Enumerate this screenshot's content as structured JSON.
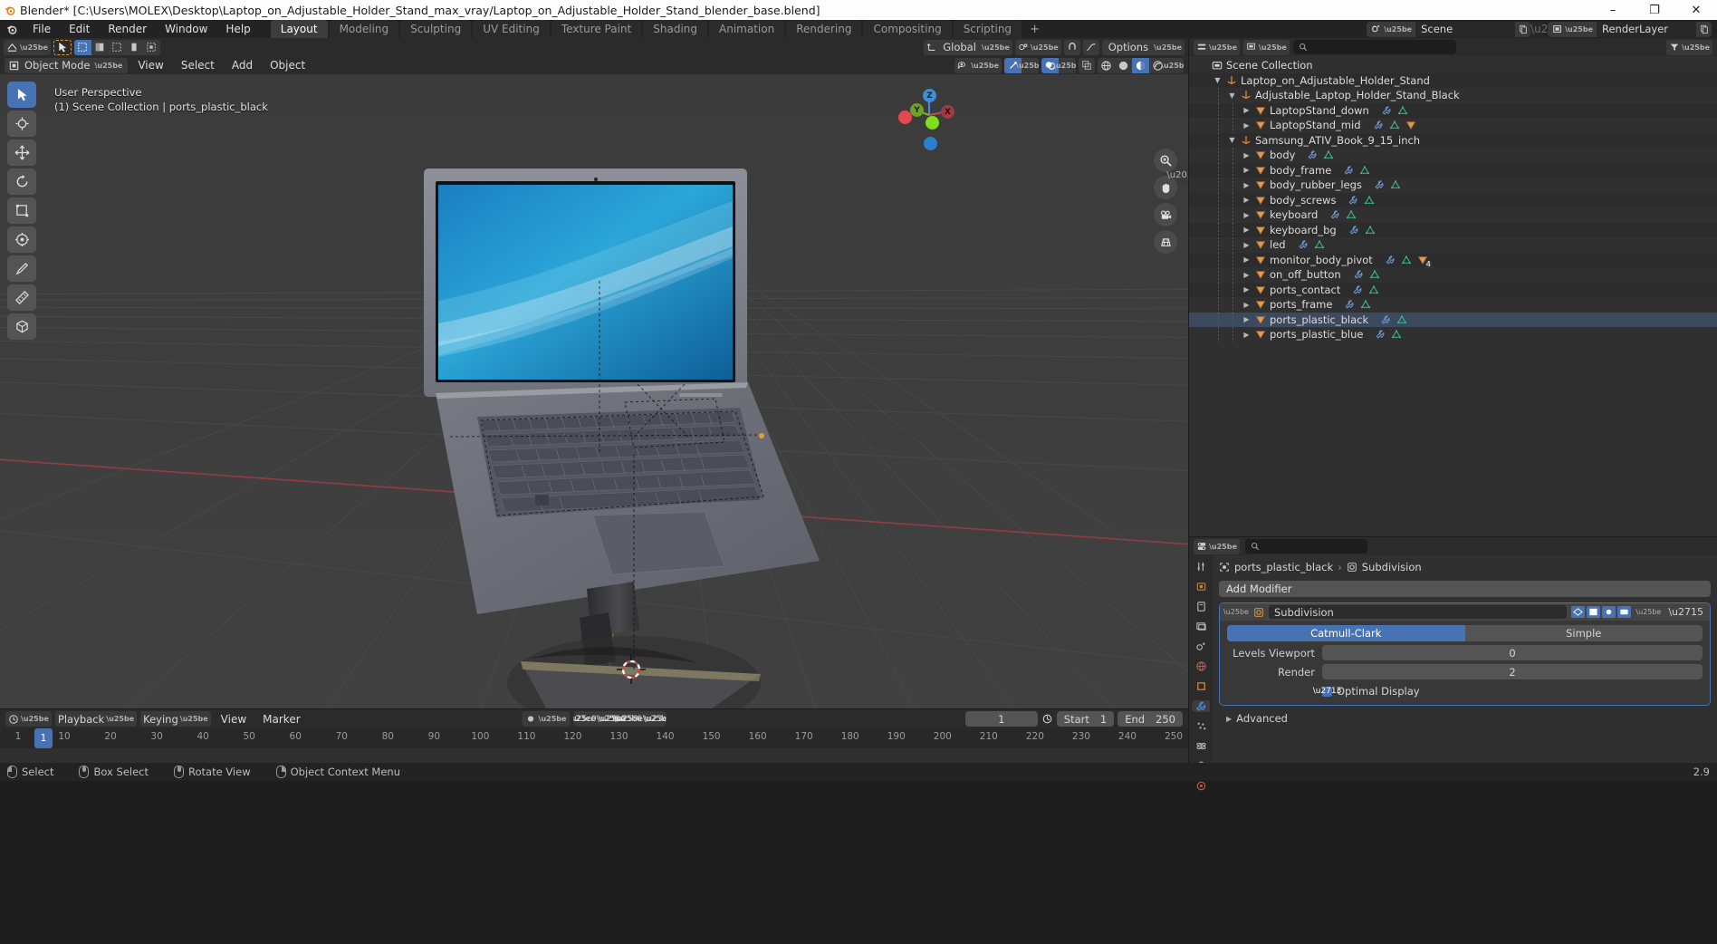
{
  "window": {
    "title": "Blender* [C:\\Users\\MOLEX\\Desktop\\Laptop_on_Adjustable_Holder_Stand_max_vray/Laptop_on_Adjustable_Holder_Stand_blender_base.blend]",
    "minimize": "–",
    "maximize": "❐",
    "close": "✕"
  },
  "topbar": {
    "menus": [
      "File",
      "Edit",
      "Render",
      "Window",
      "Help"
    ],
    "workspaces": [
      {
        "label": "Layout",
        "active": true
      },
      {
        "label": "Modeling",
        "active": false
      },
      {
        "label": "Sculpting",
        "active": false
      },
      {
        "label": "UV Editing",
        "active": false
      },
      {
        "label": "Texture Paint",
        "active": false
      },
      {
        "label": "Shading",
        "active": false
      },
      {
        "label": "Animation",
        "active": false
      },
      {
        "label": "Rendering",
        "active": false
      },
      {
        "label": "Compositing",
        "active": false
      },
      {
        "label": "Scripting",
        "active": false
      }
    ],
    "add_workspace": "+",
    "scene_name": "Scene",
    "view_layer_name": "RenderLayer"
  },
  "viewport_header": {
    "editor_type": "editor-type-icon",
    "transform_orientation": "Global",
    "options_label": "Options",
    "snap_icon": "magnet-icon",
    "proportional_icon": "proportional-edit-icon"
  },
  "tool_header": {
    "mode": "Object Mode",
    "menus": [
      "View",
      "Select",
      "Add",
      "Object"
    ]
  },
  "viewport": {
    "perspective_label": "User Perspective",
    "collection_label": "(1) Scene Collection | ports_plastic_black",
    "gizmo_axes": [
      "X",
      "Y",
      "Z"
    ],
    "axis_colors": {
      "x": "#c44a53",
      "y": "#7bb12a",
      "z": "#3f8ed6"
    },
    "background": "#3d3d3d"
  },
  "outliner": {
    "search_placeholder": "",
    "rows": [
      {
        "label": "Scene Collection",
        "depth": 0,
        "icon": "collection-icon",
        "expand": "",
        "selected": false,
        "icons": []
      },
      {
        "label": "Laptop_on_Adjustable_Holder_Stand",
        "depth": 1,
        "icon": "empty-axes-icon",
        "expand": "▼",
        "selected": false,
        "icons": []
      },
      {
        "label": "Adjustable_Laptop_Holder_Stand_Black",
        "depth": 2,
        "icon": "empty-axes-icon",
        "expand": "▼",
        "selected": false,
        "icons": []
      },
      {
        "label": "LaptopStand_down",
        "depth": 3,
        "icon": "mesh-data-icon",
        "expand": "▶",
        "selected": false,
        "icons": [
          "modifier-icon",
          "mesh-icon"
        ]
      },
      {
        "label": "LaptopStand_mid",
        "depth": 3,
        "icon": "mesh-data-icon",
        "expand": "▶",
        "selected": false,
        "icons": [
          "modifier-icon",
          "mesh-icon",
          "mesh-data-icon"
        ]
      },
      {
        "label": "Samsung_ATIV_Book_9_15_inch",
        "depth": 2,
        "icon": "empty-axes-icon",
        "expand": "▼",
        "selected": false,
        "icons": []
      },
      {
        "label": "body",
        "depth": 3,
        "icon": "mesh-data-icon",
        "expand": "▶",
        "selected": false,
        "icons": [
          "modifier-icon",
          "mesh-icon"
        ]
      },
      {
        "label": "body_frame",
        "depth": 3,
        "icon": "mesh-data-icon",
        "expand": "▶",
        "selected": false,
        "icons": [
          "modifier-icon",
          "mesh-icon"
        ]
      },
      {
        "label": "body_rubber_legs",
        "depth": 3,
        "icon": "mesh-data-icon",
        "expand": "▶",
        "selected": false,
        "icons": [
          "modifier-icon",
          "mesh-icon"
        ]
      },
      {
        "label": "body_screws",
        "depth": 3,
        "icon": "mesh-data-icon",
        "expand": "▶",
        "selected": false,
        "icons": [
          "modifier-icon",
          "mesh-icon"
        ]
      },
      {
        "label": "keyboard",
        "depth": 3,
        "icon": "mesh-data-icon",
        "expand": "▶",
        "selected": false,
        "icons": [
          "modifier-icon",
          "mesh-icon"
        ]
      },
      {
        "label": "keyboard_bg",
        "depth": 3,
        "icon": "mesh-data-icon",
        "expand": "▶",
        "selected": false,
        "icons": [
          "modifier-icon",
          "mesh-icon"
        ]
      },
      {
        "label": "led",
        "depth": 3,
        "icon": "mesh-data-icon",
        "expand": "▶",
        "selected": false,
        "icons": [
          "modifier-icon",
          "mesh-icon"
        ]
      },
      {
        "label": "monitor_body_pivot",
        "depth": 3,
        "icon": "mesh-data-icon",
        "expand": "▶",
        "selected": false,
        "icons": [
          "modifier-icon",
          "mesh-icon",
          "mesh-data-badge-4"
        ]
      },
      {
        "label": "on_off_button",
        "depth": 3,
        "icon": "mesh-data-icon",
        "expand": "▶",
        "selected": false,
        "icons": [
          "modifier-icon",
          "mesh-icon"
        ]
      },
      {
        "label": "ports_contact",
        "depth": 3,
        "icon": "mesh-data-icon",
        "expand": "▶",
        "selected": false,
        "icons": [
          "modifier-icon",
          "mesh-icon"
        ]
      },
      {
        "label": "ports_frame",
        "depth": 3,
        "icon": "mesh-data-icon",
        "expand": "▶",
        "selected": false,
        "icons": [
          "modifier-icon",
          "mesh-icon"
        ]
      },
      {
        "label": "ports_plastic_black",
        "depth": 3,
        "icon": "mesh-data-icon",
        "expand": "▶",
        "selected": true,
        "icons": [
          "modifier-icon",
          "mesh-icon"
        ]
      },
      {
        "label": "ports_plastic_blue",
        "depth": 3,
        "icon": "mesh-data-icon",
        "expand": "▶",
        "selected": false,
        "icons": [
          "modifier-icon",
          "mesh-icon"
        ]
      }
    ],
    "badge_count": "4"
  },
  "properties": {
    "search_placeholder": "",
    "breadcrumb_object": "ports_plastic_black",
    "breadcrumb_modifier": "Subdivision",
    "breadcrumb_sep": "›",
    "add_modifier_label": "Add Modifier",
    "modifier": {
      "name": "Subdivision",
      "types": [
        {
          "label": "Catmull-Clark",
          "active": true
        },
        {
          "label": "Simple",
          "active": false
        }
      ],
      "fields": [
        {
          "label": "Levels Viewport",
          "value": "0"
        },
        {
          "label": "Render",
          "value": "2"
        }
      ],
      "optimal_display_label": "Optimal Display",
      "optimal_display_checked": true,
      "advanced_label": "Advanced",
      "advanced_tri": "▶"
    },
    "accent_color": "#4772b3"
  },
  "timeline": {
    "menus": [
      "View",
      "Marker"
    ],
    "playback_label": "Playback",
    "keying_label": "Keying",
    "current_frame": "1",
    "start_label": "Start",
    "start_value": "1",
    "end_label": "End",
    "end_value": "250",
    "ticks": [
      "1",
      "10",
      "20",
      "30",
      "40",
      "50",
      "60",
      "70",
      "80",
      "90",
      "100",
      "110",
      "120",
      "130",
      "140",
      "150",
      "160",
      "170",
      "180",
      "190",
      "200",
      "210",
      "220",
      "230",
      "240",
      "250"
    ],
    "playhead_label": "1"
  },
  "statusbar": {
    "items": [
      {
        "label": "Select",
        "mouse": "left"
      },
      {
        "label": "Box Select",
        "mouse": "mid"
      },
      {
        "label": "Object Context Menu",
        "mouse": "right"
      }
    ],
    "version": "2.9"
  }
}
